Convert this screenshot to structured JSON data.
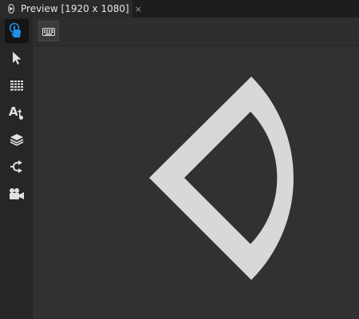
{
  "tab": {
    "title": "Preview [1920 x 1080]",
    "close_glyph": "×",
    "icon": "play-circle-icon"
  },
  "toolbar": {
    "tools": [
      {
        "name": "interact-tool",
        "icon": "pointer-hand-icon",
        "active": true
      },
      {
        "name": "select-tool",
        "icon": "arrow-cursor-icon",
        "active": false
      },
      {
        "name": "grid-tool",
        "icon": "grid-table-icon",
        "active": false
      },
      {
        "name": "text-tool",
        "icon": "text-style-icon",
        "active": false
      },
      {
        "name": "layers-tool",
        "icon": "layers-icon",
        "active": false
      },
      {
        "name": "connect-tool",
        "icon": "connect-arrow-icon",
        "active": false
      },
      {
        "name": "camera-tool",
        "icon": "video-camera-icon",
        "active": false
      }
    ]
  },
  "topbar": {
    "keyboard_button_icon": "keyboard-icon"
  },
  "colors": {
    "accent": "#1e8fe6",
    "canvas_bg": "#313131",
    "shape_fill": "#d8d8d8"
  }
}
